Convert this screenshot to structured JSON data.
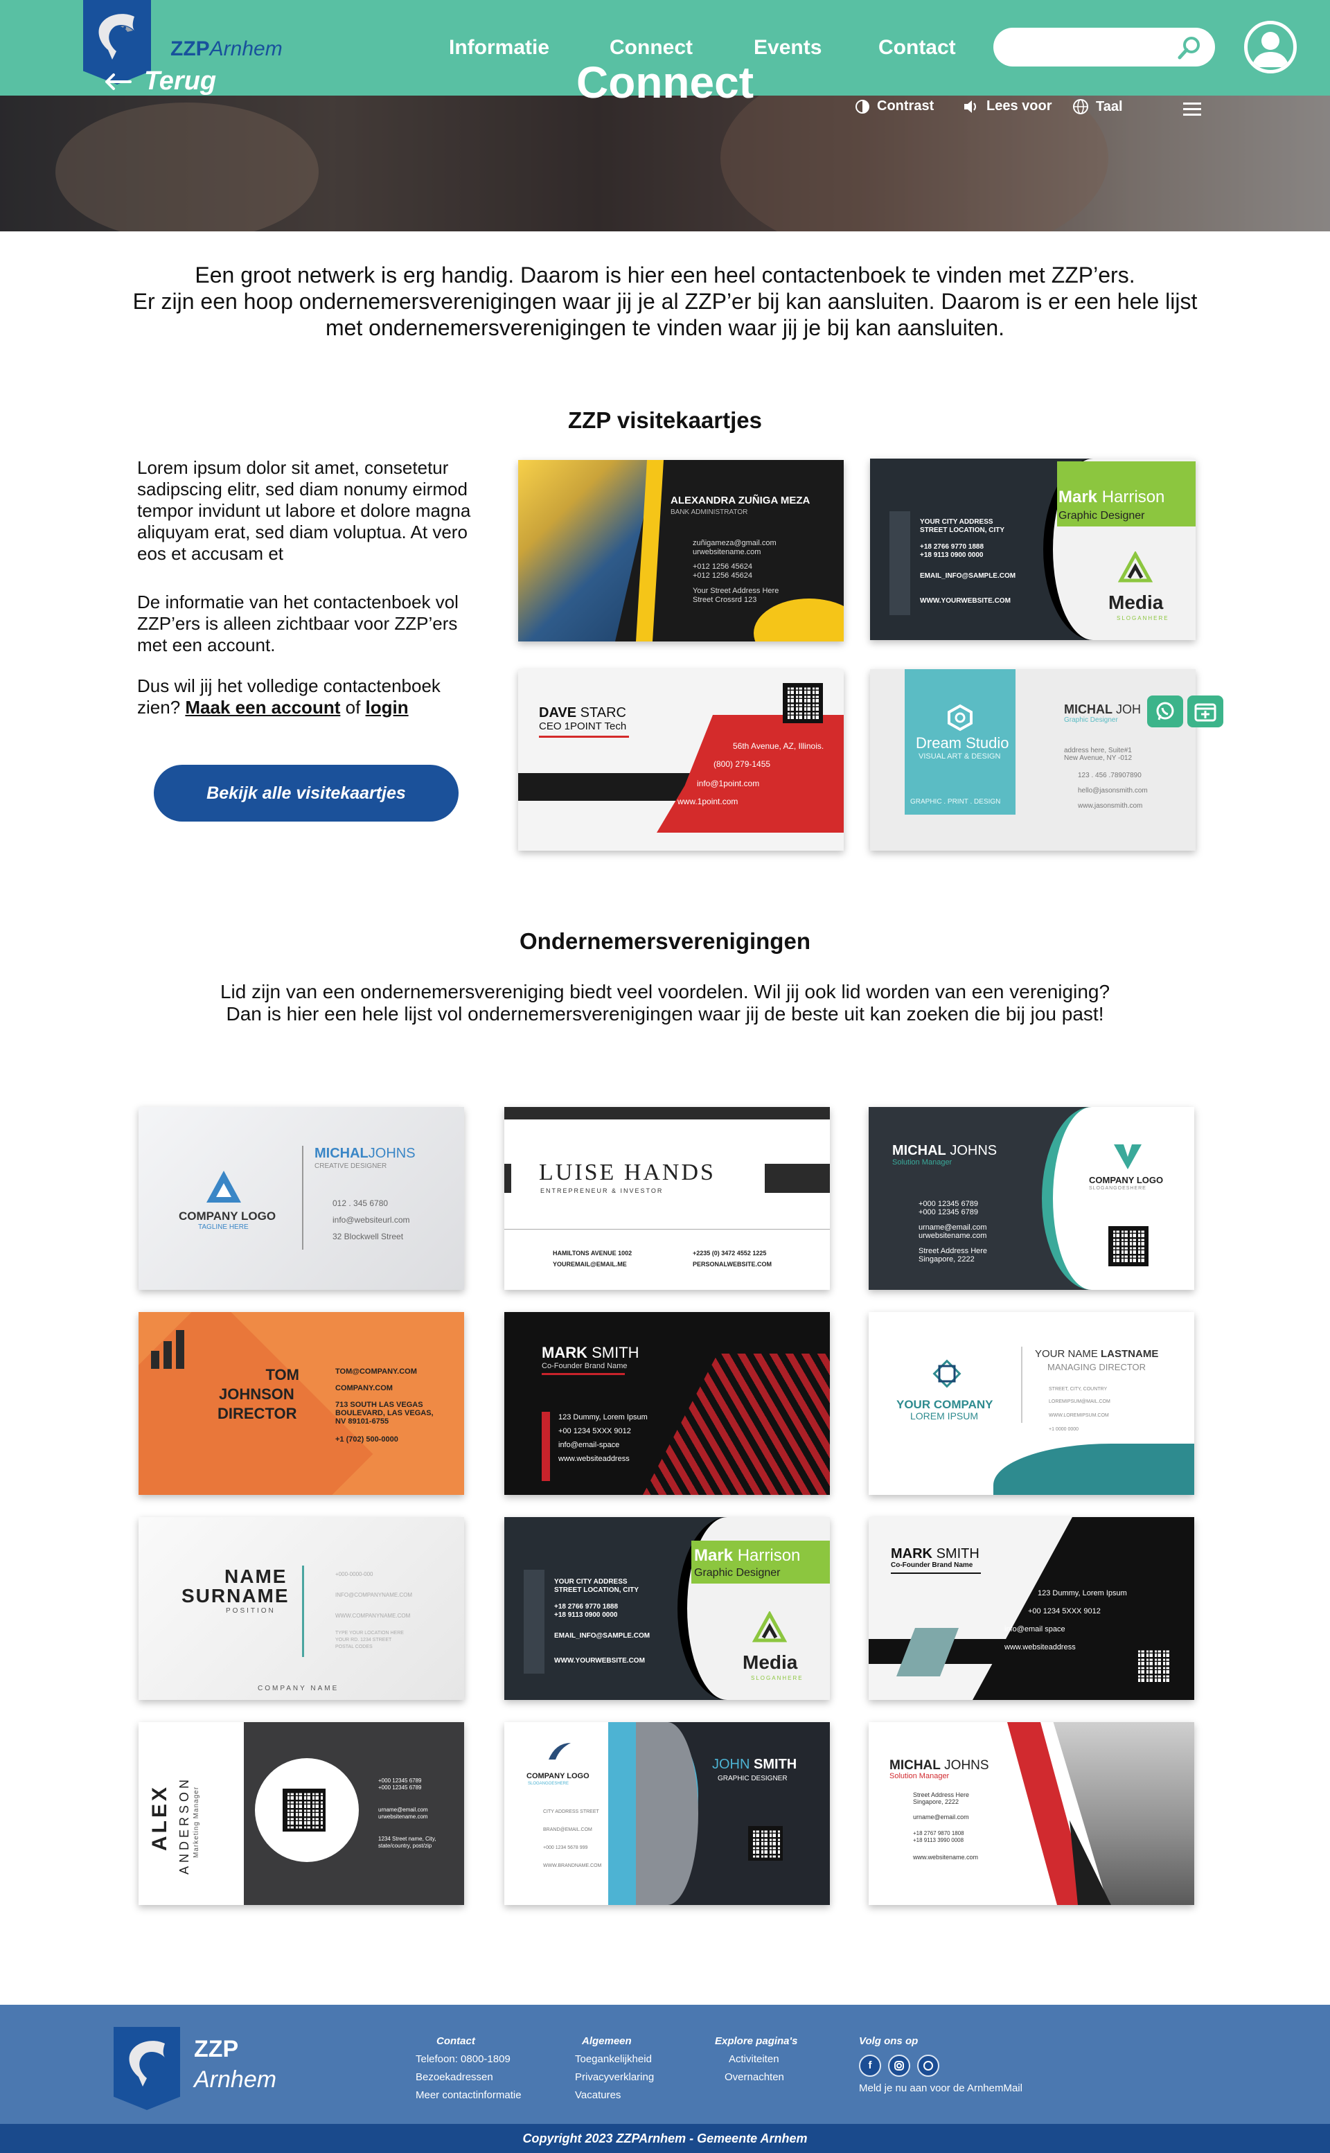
{
  "header": {
    "logo_bold": "ZZP",
    "logo_italic": "Arnhem",
    "nav": [
      "Informatie",
      "Connect",
      "Events",
      "Contact"
    ],
    "search_placeholder": ""
  },
  "hero": {
    "back_label": "Terug",
    "title": "Connect",
    "tools": [
      "Contrast",
      "Lees voor",
      "Taal"
    ]
  },
  "intro": {
    "line1": "Een groot netwerk is erg handig. Daarom is hier een heel contactenboek te vinden met ZZP’ers.",
    "line2": "Er zijn een hoop ondernemersverenigingen waar jij je al ZZP’er bij kan aansluiten. Daarom is er een hele lijst",
    "line3": "met ondernemersverenigingen te vinden waar jij je bij kan aansluiten."
  },
  "visitekaartjes": {
    "title": "ZZP visitekaartjes",
    "p1": "Lorem ipsum dolor sit amet, consetetur sadipscing elitr, sed diam nonumy eirmod tempor invidunt ut labore et dolore magna aliquyam erat, sed diam voluptua. At vero eos et accusam et",
    "p2": "De informatie van het contactenboek vol ZZP’ers is alleen zichtbaar voor ZZP’ers met een account.",
    "p3_before": "Dus wil jij het volledige contactenboek zien?",
    "p3_link1": "Maak een account",
    "p3_mid": "of",
    "p3_link2": "login",
    "cta": "Bekijk alle visitekaartjes",
    "cards": {
      "c1": {
        "name": "ALEXANDRA ZUÑIGA MEZA",
        "role": "BANK ADMINISTRATOR",
        "l1": "zuñigameza@gmail.com",
        "l2": "urwebsitename.com",
        "l3": "+012 1256 45624",
        "l4": "+012 1256 45624",
        "l5": "Your Street Address Here",
        "l6": "Street Crossrd 123"
      },
      "c2": {
        "first": "Mark",
        "last": "Harrison",
        "role": "Graphic Designer",
        "l1": "YOUR CITY ADDRESS",
        "l2": "STREET LOCATION, CITY",
        "l3": "+18 2766 9770 1888",
        "l4": "+18 9113 0900 0000",
        "l5": "EMAIL_INFO@SAMPLE.COM",
        "l6": "WWW.YOURWEBSITE.COM",
        "brand": "Media",
        "tag": "SLOGANHERE"
      },
      "c3": {
        "first": "DAVE",
        "last": "STARC",
        "role": "CEO 1POINT Tech",
        "l1": "56th Avenue, AZ, Illinois.",
        "l2": "(800) 279-1455",
        "l3": "info@1point.com",
        "l4": "www.1point.com"
      },
      "c4": {
        "brand": "Dream Studio",
        "sub": "VISUAL ART & DESIGN",
        "foot": "GRAPHIC . PRINT . DESIGN",
        "first": "MICHAL",
        "last": "JOH",
        "role": "Graphic Designer",
        "l1": "address here, Suite#1",
        "l2": "New Avenue, NY -012",
        "l3": "123 . 456 .78907890",
        "l4": "hello@jasonsmith.com",
        "l5": "www.jasonsmith.com"
      }
    }
  },
  "verenigingen": {
    "title": "Ondernemersverenigingen",
    "line1": "Lid zijn van een ondernemersvereniging biedt veel voordelen. Wil jij ook lid worden van een vereniging?",
    "line2": "Dan is hier een hele lijst vol ondernemersverenigingen waar jij de beste uit kan zoeken die bij jou past!",
    "cards": {
      "v1": {
        "first": "MICHAL",
        "last": "JOHNS",
        "role": "CREATIVE DESIGNER",
        "logo": "COMPANY LOGO",
        "tag": "TAGLINE HERE",
        "l1": "012 . 345 6780",
        "l2": "info@websiteurl.com",
        "l3": "32 Blockwell Street"
      },
      "v2": {
        "name": "LUISE HANDS",
        "role": "ENTREPRENEUR & INVESTOR",
        "l1": "HAMILTONS AVENUE 1002",
        "l2": "YOUREMAIL@EMAIL.ME",
        "l3": "+2235 (0) 3472 4552 1225",
        "l4": "PERSONALWEBSITE.COM"
      },
      "v3": {
        "first": "MICHAL",
        "last": "JOHNS",
        "role": "Solution Manager",
        "l1": "+000 12345 6789",
        "l2": "+000 12345 6789",
        "l3": "urname@email.com",
        "l4": "urwebsitename.com",
        "l5": "Street Address Here",
        "l6": "Singapore, 2222",
        "logo": "COMPANY LOGO",
        "tag": "SLOGANGOESHERE"
      },
      "v4": {
        "n1": "TOM",
        "n2": "JOHNSON",
        "n3": "DIRECTOR",
        "l1": "TOM@COMPANY.COM",
        "l2": "COMPANY.COM",
        "l3": "713 SOUTH LAS VEGAS",
        "l4": "BOULEVARD, LAS VEGAS,",
        "l5": "NV 89101-6755",
        "l6": "+1 (702) 500-0000"
      },
      "v5": {
        "first": "MARK",
        "last": "SMITH",
        "role": "Co-Founder Brand Name",
        "l1": "123 Dummy, Lorem Ipsum",
        "l2": "+00 1234 5XXX 9012",
        "l3": "info@email-space",
        "l4": "www.websiteaddress"
      },
      "v6": {
        "logo1": "YOUR COMPANY",
        "logo2": "LOREM IPSUM",
        "first": "YOUR NAME",
        "last": "LASTNAME",
        "role": "MANAGING DIRECTOR",
        "l1": "STREET, CITY, COUNTRY",
        "l2": "LOREMIPSUM@MAIL.COM",
        "l3": "WWW.LOREMIPSUM.COM",
        "l4": "+1 0000 0000"
      },
      "v7": {
        "n1": "NAME",
        "n2": "SURNAME",
        "role": "POSITION",
        "l1": "+000-0000-000",
        "l2": "INFO@COMPANYNAME.COM",
        "l3": "WWW.COMPANYNAME.COM",
        "l4": "TYPE YOUR LOCATION HERE",
        "l5": "YOUR RD. 1234 STREET",
        "l6": "POSTAL CODES",
        "foot": "COMPANY NAME"
      },
      "v8": {
        "first": "Mark",
        "last": "Harrison",
        "role": "Graphic Designer",
        "l1": "YOUR CITY ADDRESS",
        "l2": "STREET LOCATION, CITY",
        "l3": "+18 2766 9770 1888",
        "l4": "+18 9113 0900 0000",
        "l5": "EMAIL_INFO@SAMPLE.COM",
        "l6": "WWW.YOURWEBSITE.COM",
        "brand": "Media",
        "tag": "SLOGANHERE"
      },
      "v9": {
        "first": "MARK",
        "last": "SMITH",
        "role": "Co-Founder Brand Name",
        "l1": "123 Dummy, Lorem Ipsum",
        "l2": "+00 1234 5XXX 9012",
        "l3": "info@email space",
        "l4": "www.websiteaddress"
      },
      "v10": {
        "n1": "ALEX",
        "n2": "ANDERSON",
        "role": "Marketing Manager",
        "l1": "+000 12345 6789",
        "l2": "+000 12345 6789",
        "l3": "urname@email.com",
        "l4": "urwebsitename.com",
        "l5": "1234 Street name, City,",
        "l6": "state/country, post/zip"
      },
      "v11": {
        "logo": "COMPANY LOGO",
        "tag": "SLOGANGOESHERE",
        "first": "JOHN",
        "last": "SMITH",
        "role": "GRAPHIC DESIGNER",
        "l1": "CITY ADDRESS STREET",
        "l2": "BRAND@EMAIL.COM",
        "l3": "+000 1234 5678 999",
        "l4": "WWW.BRANDNAME.COM"
      },
      "v12": {
        "first": "MICHAL",
        "last": "JOHNS",
        "role": "Solution Manager",
        "l1": "Street Address Here",
        "l2": "Singapore, 2222",
        "l3": "urname@email.com",
        "l4": "+18 2767 9870 1808",
        "l5": "+18 9113 3990 0008",
        "l6": "www.websitename.com"
      }
    }
  },
  "footer": {
    "logo_bold": "ZZP",
    "logo_italic": "Arnhem",
    "contact": {
      "title": "Contact",
      "items": [
        "Telefoon: 0800-1809",
        "Bezoekadressen",
        "Meer contactinformatie"
      ]
    },
    "algemeen": {
      "title": "Algemeen",
      "items": [
        "Toegankelijkheid",
        "Privacyverklaring",
        "Vacatures"
      ]
    },
    "explore": {
      "title": "Explore pagina's",
      "items": [
        "Activiteiten",
        "Overnachten"
      ]
    },
    "volg": {
      "title": "Volg ons op",
      "mail": "Meld je nu aan voor de ArnhemMail"
    },
    "copyright": "Copyright 2023 ZZPArnhem - Gemeente Arnhem"
  }
}
